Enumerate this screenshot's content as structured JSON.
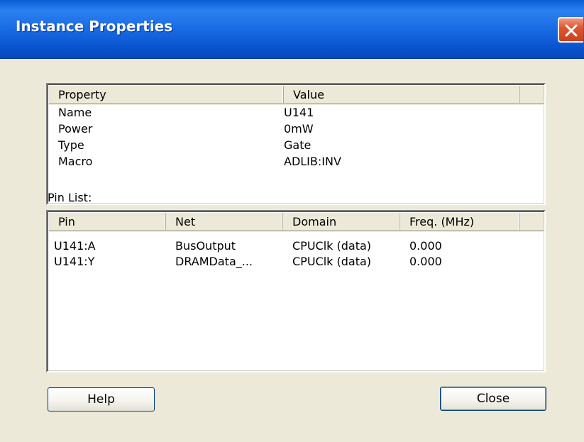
{
  "window": {
    "title": "Instance Properties"
  },
  "properties": {
    "headers": [
      "Property",
      "Value"
    ],
    "rows": [
      {
        "property": "Name",
        "value": "U141"
      },
      {
        "property": "Power",
        "value": "0mW"
      },
      {
        "property": "Type",
        "value": "Gate"
      },
      {
        "property": "Macro",
        "value": "ADLIB:INV"
      }
    ]
  },
  "pins": {
    "label": "Pin List:",
    "headers": [
      "Pin",
      "Net",
      "Domain",
      "Freq. (MHz)"
    ],
    "rows": [
      {
        "pin": "U141:A",
        "net": "BusOutput",
        "domain": "CPUClk (data)",
        "freq": "0.000"
      },
      {
        "pin": "U141:Y",
        "net": "DRAMData_...",
        "domain": "CPUClk (data)",
        "freq": "0.000"
      }
    ]
  },
  "buttons": {
    "help": "Help",
    "close": "Close"
  },
  "icons": {
    "close": "close-x-icon"
  },
  "colors": {
    "titlebar": "#0a5ed6",
    "close_button": "#e0562e",
    "dialog_bg": "#ece9d8"
  }
}
